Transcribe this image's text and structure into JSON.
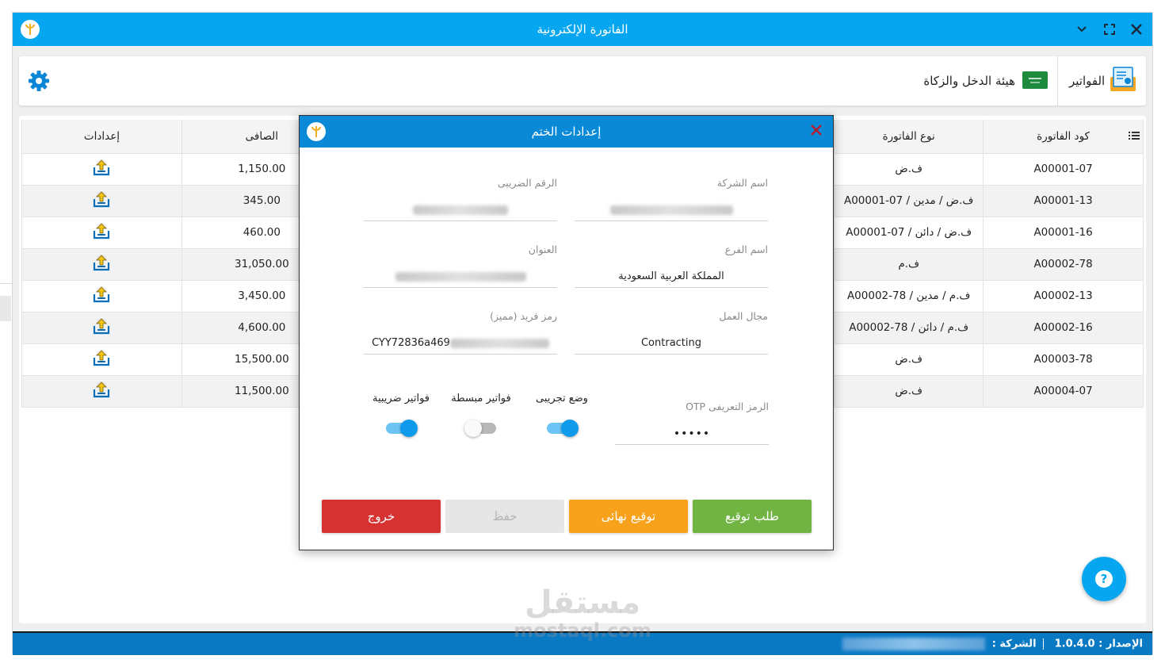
{
  "window": {
    "title": "الفاتورة الإلكترونية"
  },
  "topbar": {
    "invoices_label": "الفواتير",
    "authority_label": "هيئة الدخل والزكاة"
  },
  "table": {
    "headers": {
      "code": "كود الفاتورة",
      "type": "نوع الفاتورة",
      "net": "الصافى",
      "settings": "إعدادات"
    },
    "rows": [
      {
        "code": "A00001-07",
        "type": "ف.ض",
        "net": "1,150.00"
      },
      {
        "code": "A00001-13",
        "type": "ف.ض / مدين / A00001-07",
        "net": "345.00"
      },
      {
        "code": "A00001-16",
        "type": "ف.ض / دائن / A00001-07",
        "net": "460.00"
      },
      {
        "code": "A00002-78",
        "type": "ف.م",
        "net": "31,050.00"
      },
      {
        "code": "A00002-13",
        "type": "ف.م / مدين / A00002-78",
        "net": "3,450.00"
      },
      {
        "code": "A00002-16",
        "type": "ف.م / دائن / A00002-78",
        "net": "4,600.00"
      },
      {
        "code": "A00003-78",
        "type": "ف.ض",
        "net": "15,500.00"
      },
      {
        "code": "A00004-07",
        "type": "ف.ض",
        "net": "11,500.00"
      }
    ]
  },
  "modal": {
    "title": "إعدادات الختم",
    "fields": {
      "company_name": {
        "label": "اسم الشركة"
      },
      "tax_number": {
        "label": "الرقم الضريبى"
      },
      "branch_name": {
        "label": "اسم الفرع",
        "value": "المملكة العربية السعودية"
      },
      "address": {
        "label": "العنوان"
      },
      "work_field": {
        "label": "مجال العمل",
        "value": "Contracting"
      },
      "unique_code": {
        "label": "رمز فريد (مميز)",
        "value": "CYY72836a469"
      },
      "otp": {
        "label": "الرمز التعريفى OTP",
        "value": "•••••"
      }
    },
    "toggles": {
      "trial_mode": {
        "label": "وضع تجريبى",
        "on": true
      },
      "simplified": {
        "label": "فواتير مبسطة",
        "on": false
      },
      "tax_invoices": {
        "label": "فواتير ضريبية",
        "on": true
      }
    },
    "buttons": {
      "sign_request": "طلب توقيع",
      "final_sign": "توقيع نهائى",
      "save": "حفظ",
      "exit": "خروج"
    }
  },
  "statusbar": {
    "version_text": "الإصدار : 1.0.4.0",
    "company_text": "الشركة :"
  },
  "help": {
    "label": "?"
  },
  "watermark": {
    "ar": "مستقل",
    "en": "mostaql.com"
  }
}
